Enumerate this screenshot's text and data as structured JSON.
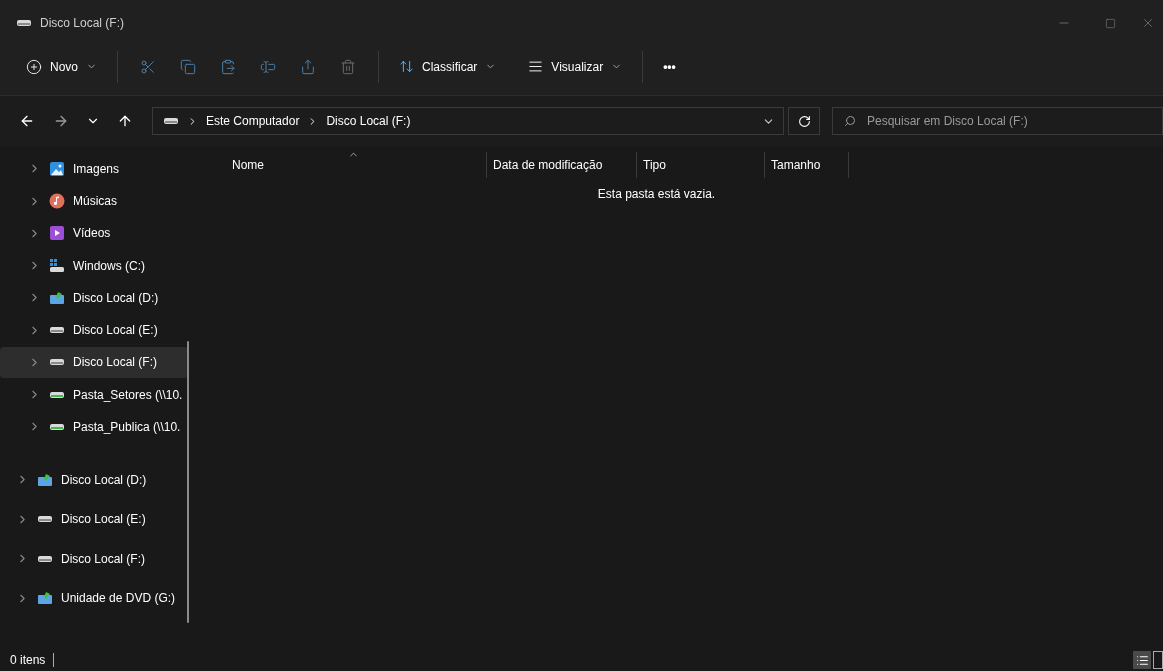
{
  "window": {
    "title": "Disco Local (F:)"
  },
  "toolbar": {
    "new_button": "Novo",
    "sort_button": "Classificar",
    "view_button": "Visualizar",
    "more_button": "•••"
  },
  "address_bar": {
    "path": [
      {
        "label": "Este Computador"
      },
      {
        "label": "Disco Local (F:)"
      }
    ]
  },
  "search": {
    "placeholder": "Pesquisar em Disco Local (F:)"
  },
  "sidebar": {
    "nested_items": [
      {
        "label": "Imagens",
        "kind": "pictures",
        "selected": false
      },
      {
        "label": "Músicas",
        "kind": "music",
        "selected": false
      },
      {
        "label": "Vídeos",
        "kind": "videos",
        "selected": false
      },
      {
        "label": "Windows (C:)",
        "kind": "system-drive",
        "selected": false
      },
      {
        "label": "Disco Local (D:)",
        "kind": "arrow-drive",
        "selected": false
      },
      {
        "label": "Disco Local (E:)",
        "kind": "drive",
        "selected": false
      },
      {
        "label": "Disco Local (F:)",
        "kind": "drive",
        "selected": true
      },
      {
        "label": "Pasta_Setores (\\\\10.",
        "kind": "network-drive",
        "selected": false
      },
      {
        "label": "Pasta_Publica (\\\\10.",
        "kind": "network-drive",
        "selected": false
      }
    ],
    "items": [
      {
        "label": "Disco Local (D:)",
        "kind": "arrow-drive",
        "selected": false
      },
      {
        "label": "Disco Local (E:)",
        "kind": "drive",
        "selected": false
      },
      {
        "label": "Disco Local (F:)",
        "kind": "drive",
        "selected": false
      },
      {
        "label": "Unidade de DVD (G:)",
        "kind": "arrow-drive",
        "selected": false
      }
    ]
  },
  "table": {
    "columns": [
      "Nome",
      "Data de modificação",
      "Tipo",
      "Tamanho"
    ],
    "empty_message": "Esta pasta está vazia."
  },
  "status_bar": {
    "item_count": "0 itens"
  }
}
